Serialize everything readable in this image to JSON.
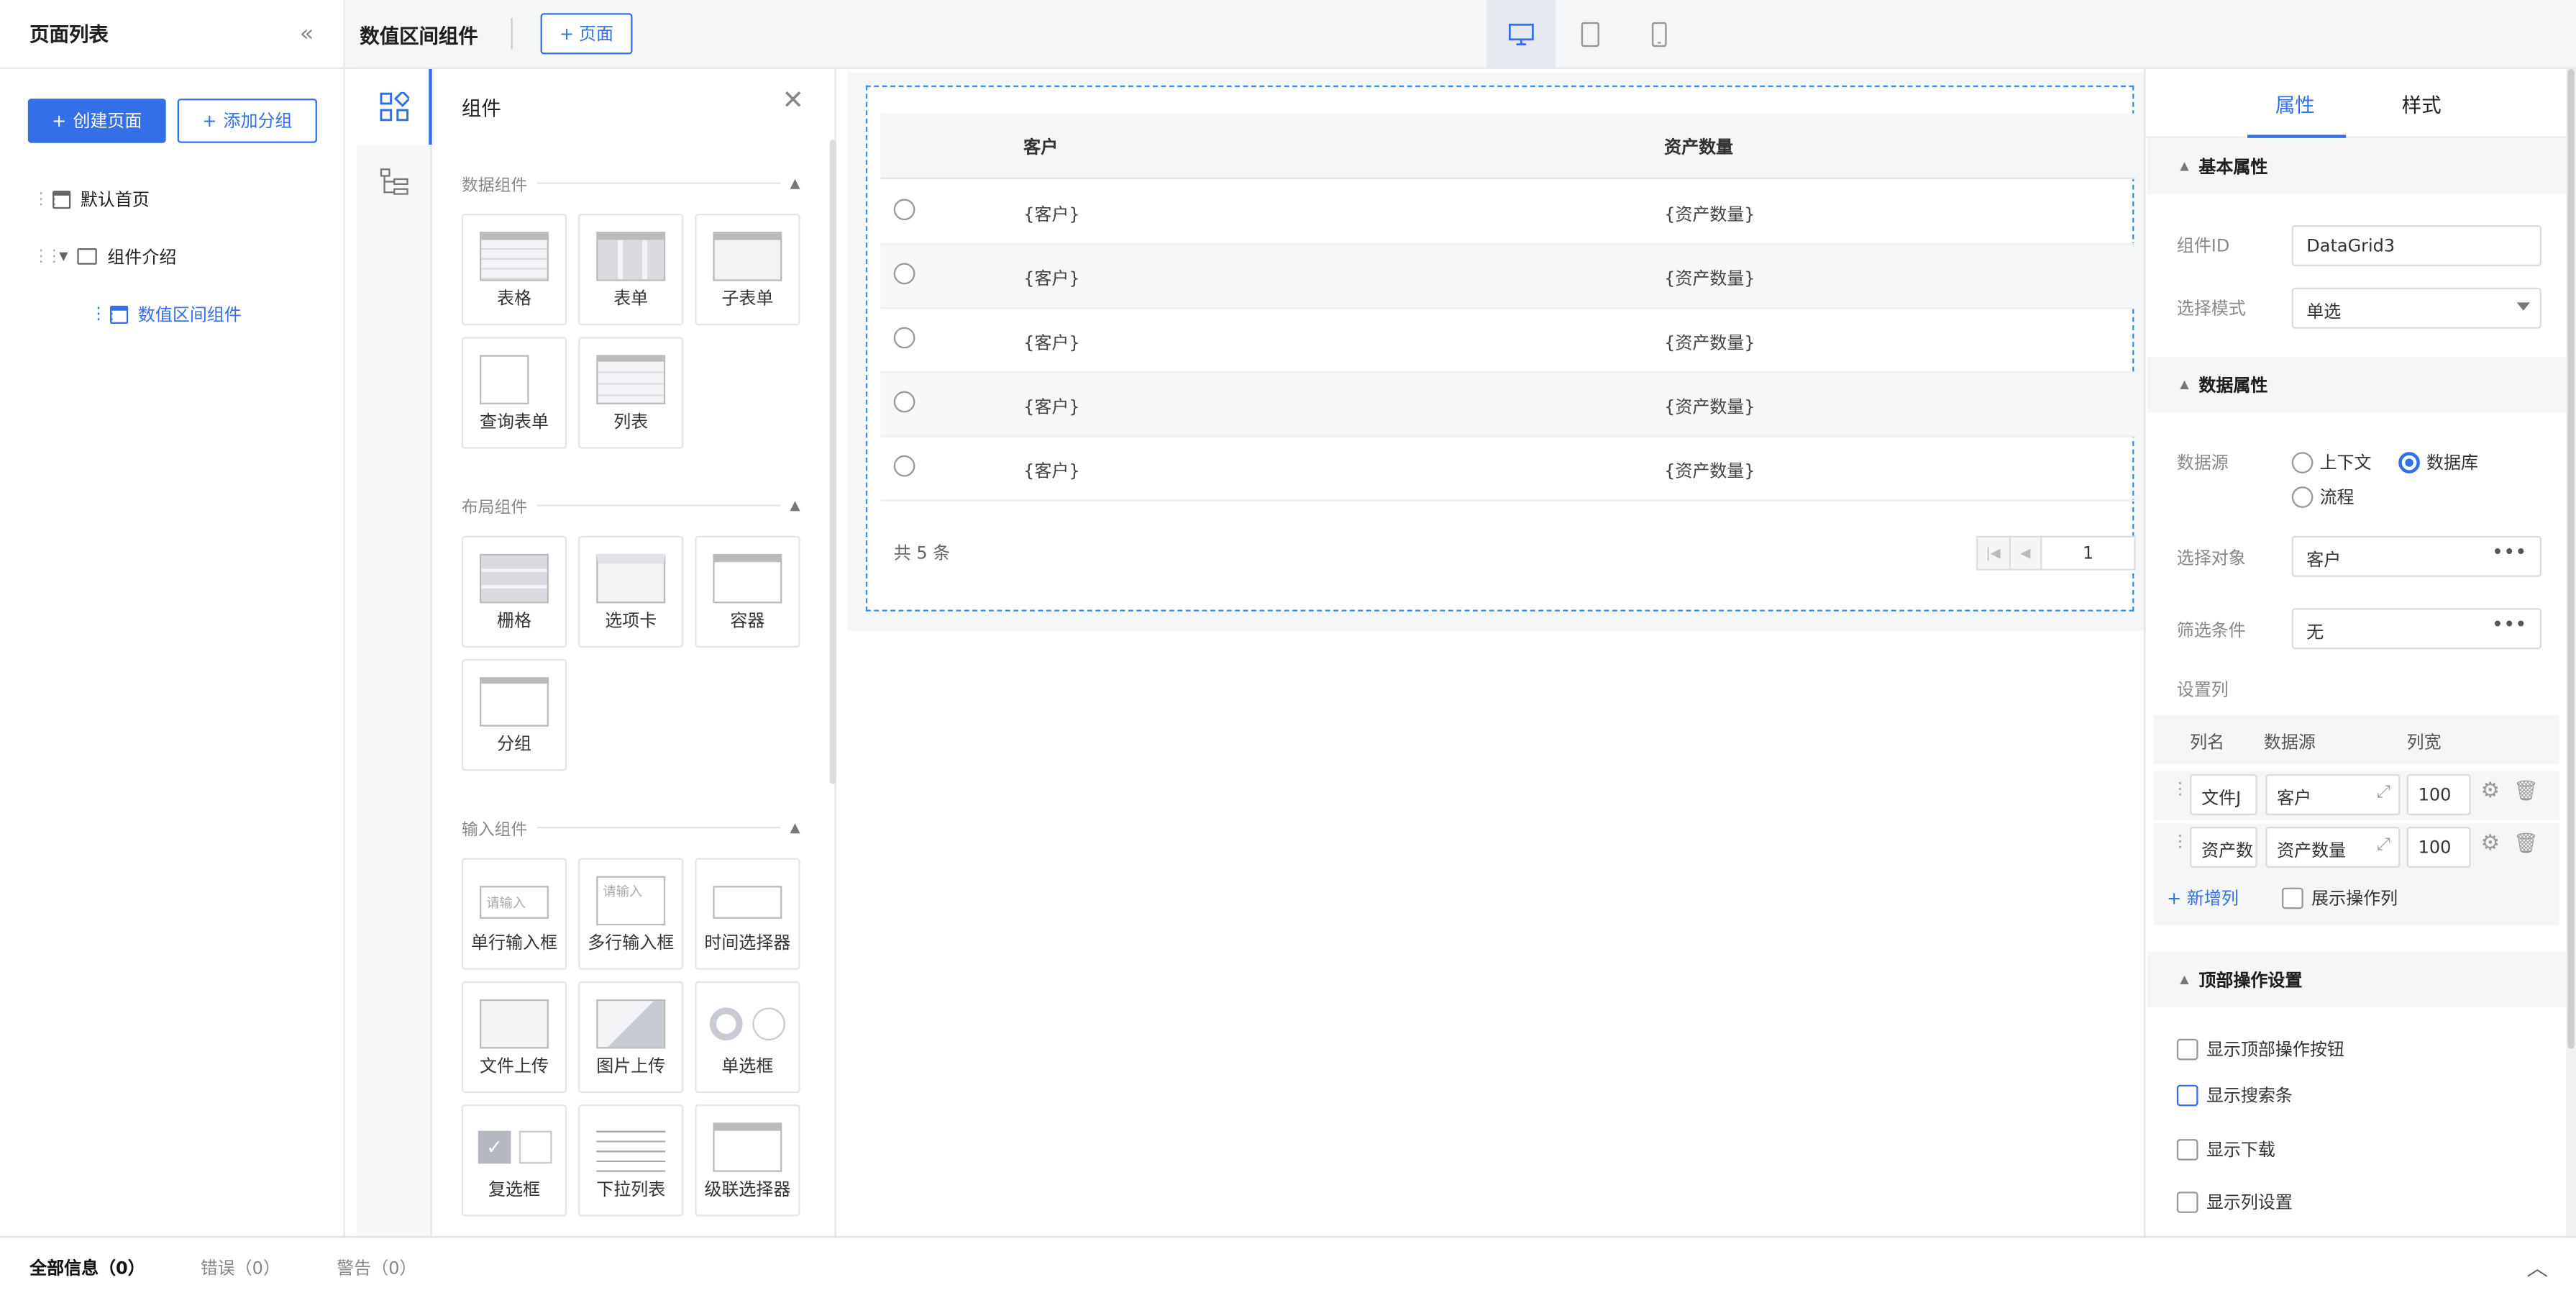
{
  "left": {
    "title": "页面列表",
    "collapse_icon": "«",
    "create_btn": "创建页面",
    "add_group_btn": "添加分组",
    "tree": [
      {
        "label": "默认首页"
      },
      {
        "label": "组件介绍"
      },
      {
        "label": "数值区间组件"
      }
    ]
  },
  "topbar": {
    "doc_title": "数值区间组件",
    "page_btn": "页面",
    "devices": [
      "desktop-icon",
      "tablet-icon",
      "mobile-icon"
    ]
  },
  "components": {
    "title": "组件",
    "sections": [
      {
        "title": "数据组件",
        "items": [
          "表格",
          "表单",
          "子表单",
          "查询表单",
          "列表"
        ]
      },
      {
        "title": "布局组件",
        "items": [
          "栅格",
          "选项卡",
          "容器",
          "分组"
        ]
      },
      {
        "title": "输入组件",
        "items": [
          "单行输入框",
          "多行输入框",
          "时间选择器",
          "文件上传",
          "图片上传",
          "单选框",
          "复选框",
          "下拉列表",
          "级联选择器"
        ]
      }
    ],
    "input_placeholder": "请输入"
  },
  "grid": {
    "columns": [
      "客户",
      "资产数量"
    ],
    "rows": [
      [
        "{客户}",
        "{资产数量}"
      ],
      [
        "{客户}",
        "{资产数量}"
      ],
      [
        "{客户}",
        "{资产数量}"
      ],
      [
        "{客户}",
        "{资产数量}"
      ],
      [
        "{客户}",
        "{资产数量}"
      ]
    ],
    "total": "共 5 条",
    "page": "1"
  },
  "props": {
    "tabs": [
      "属性",
      "样式"
    ],
    "basic_title": "基本属性",
    "component_id_label": "组件ID",
    "component_id_value": "DataGrid3",
    "select_mode_label": "选择模式",
    "select_mode_value": "单选",
    "data_title": "数据属性",
    "datasource_label": "数据源",
    "datasource_options": [
      "上下文",
      "数据库",
      "流程"
    ],
    "datasource_selected": "数据库",
    "object_label": "选择对象",
    "object_value": "客户",
    "filter_label": "筛选条件",
    "filter_value": "无",
    "columns_label": "设置列",
    "col_headers": [
      "列名",
      "数据源",
      "列宽"
    ],
    "col_rows": [
      {
        "name": "文件J",
        "source": "客户",
        "width": "100"
      },
      {
        "name": "资产数",
        "source": "资产数量",
        "width": "100"
      }
    ],
    "add_col": "新增列",
    "show_actions": "展示操作列",
    "top_title": "顶部操作设置",
    "checkboxes": [
      "显示顶部操作按钮",
      "显示搜索条",
      "显示下载",
      "显示列设置"
    ]
  },
  "bottom": {
    "tabs": [
      "全部信息（0）",
      "错误（0）",
      "警告（0）"
    ]
  },
  "colors": {
    "accent": "#3370e8"
  }
}
